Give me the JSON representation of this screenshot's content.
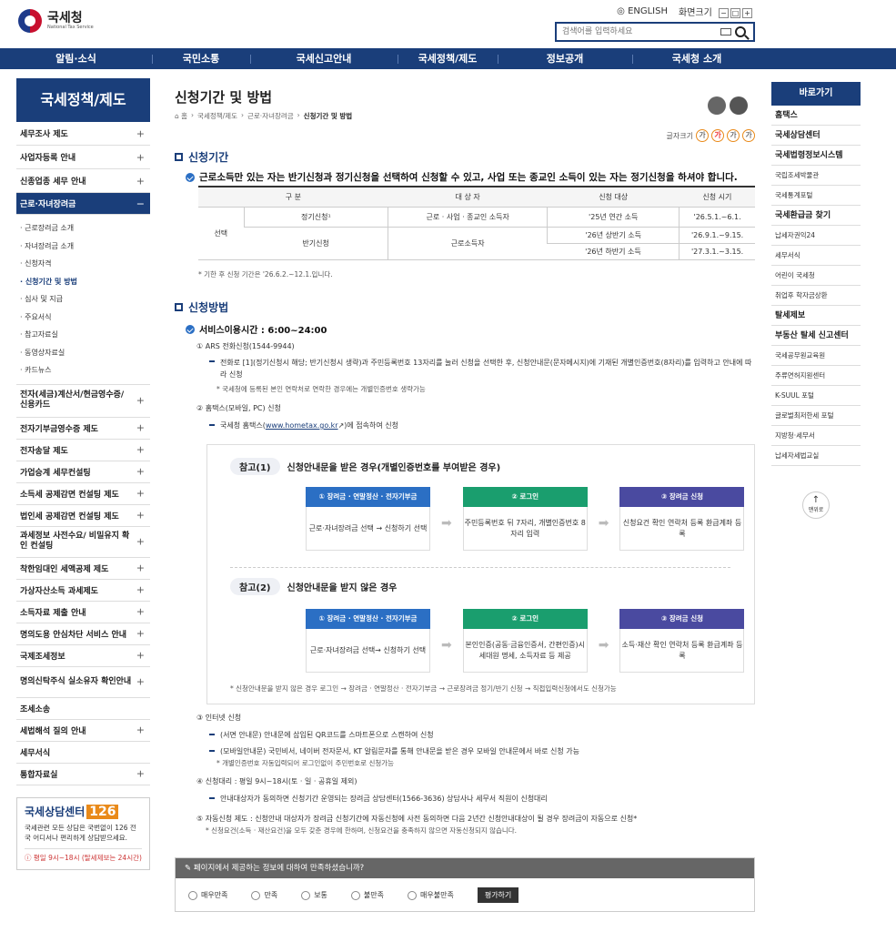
{
  "header": {
    "org_name": "국세청",
    "org_sub": "National Tax Service",
    "english": "ENGLISH",
    "zoom_label": "화면크기",
    "zoom_buttons": [
      "−",
      "□",
      "+"
    ],
    "search_placeholder": "검색어를 입력하세요"
  },
  "gnb": [
    "알림·소식",
    "국민소통",
    "국세신고안내",
    "국세정책/제도",
    "정보공개",
    "국세청 소개"
  ],
  "sidebar": {
    "title": "국세정책/제도",
    "items_top": [
      "세무조사 제도",
      "사업자등록 안내",
      "신종업종 세무 안내"
    ],
    "active": "근로·자녀장려금",
    "sub": [
      "· 근로장려금 소개",
      "· 자녀장려금 소개",
      "· 신청자격",
      "· 신청기간 및 방법",
      "· 심사 및 지급",
      "· 주요서식",
      "· 참고자료실",
      "· 동영상자료실",
      "· 카드뉴스"
    ],
    "items_bottom": [
      "전자(세금)계산서/현금영수증/ 신용카드",
      "전자기부금영수증 제도",
      "전자송달 제도",
      "가업승계 세무컨설팅",
      "소득세 공제감면 컨설팅 제도",
      "법인세 공제감면 컨설팅 제도",
      "과세정보 사전수요/ 비밀유지 확인 컨설팅",
      "착한임대인 세액공제 제도",
      "가상자산소득 과세제도",
      "소득자료 제출 안내",
      "명의도용 안심차단 서비스 안내",
      "국제조세정보",
      "명의신탁주식 실소유자 확인안내",
      "조세소송",
      "세법해석 질의 안내",
      "세무서식",
      "통합자료실"
    ]
  },
  "callcenter": {
    "title": "국세상담센터",
    "number": "126",
    "desc": "국세관련 모든 상담은 국번없이 126 전국 어디서나 편리하게 상담받으세요.",
    "time": "ⓘ 평일 9시~18시 (탈세제보는 24시간)"
  },
  "main": {
    "title": "신청기간 및 방법",
    "breadcrumb": [
      "⌂ 홈",
      "국세정책/제도",
      "근로·자녀장려금",
      "신청기간 및 방법"
    ],
    "fontsize_label": "글자크기",
    "fontsize_buttons": [
      "가",
      "가",
      "가",
      "가"
    ],
    "sec1_title": "신청기간",
    "sec1_check": "근로소득만 있는 자는 반기신청과 정기신청을 선택하여 신청할 수 있고, 사업 또는 종교인 소득이 있는 자는 정기신청을 하셔야 합니다.",
    "table": {
      "headers": [
        "구 분",
        "대 상 자",
        "신청 대상",
        "신청 시기"
      ],
      "group": "선택",
      "row1": [
        "정기신청¹",
        "근로 · 사업 · 종교인 소득자",
        "'25년 연간 소득",
        "'26.5.1.~6.1."
      ],
      "row2_type": "반기신청",
      "row2_target": "근로소득자",
      "row2a": [
        "'26년 상반기 소득",
        "'26.9.1.~9.15."
      ],
      "row2b": [
        "'26년 하반기 소득",
        "'27.3.1.~3.15."
      ]
    },
    "table_note": "* 기한 후 신청 기간은 '26.6.2.~12.1.입니다.",
    "sec2_title": "신청방법",
    "service_time": "서비스이용시간 : 6:00~24:00",
    "s1": "① ARS 전화신청(1544-9944)",
    "s1_d1": "전화로 [1](정기신청시 해당; 반기신청시 생략)과 주민등록번호 13자리를 눌러 신청을 선택한 후, 신청안내문(문자메시지)에 기재된 개별인증번호(8자리)를 입력하고 안내에 따라 신청",
    "s1_d2": "* 국세청에 등록된 본인 연락처로 연락한 경우에는 개별인증번호 생략가능",
    "s2": "② 홈택스(모바일, PC) 신청",
    "s2_d1a": "국세청 홈택스(",
    "s2_link": "www.hometax.go.kr",
    "s2_d1b": "↗)에 접속하여 신청",
    "ref1_label": "참고(1)",
    "ref1_title": "신청안내문을 받은 경우(개별인증번호를 부여받은 경우)",
    "ref2_label": "참고(2)",
    "ref2_title": "신청안내문을 받지 않은 경우",
    "flow_h": [
      "① 장려금 · 연말정산 · 전자기부금",
      "② 로그인",
      "③ 장려금 신청"
    ],
    "flow_colors": [
      "#2b6fc4",
      "#1a9e6e",
      "#4a4aa0"
    ],
    "flow1": [
      "근로·자녀장려금 선택 → 신청하기 선택",
      "주민등록번호 뒤 7자리, 개별인증번호 8자리 입력",
      "신청요건 확인 연락처 등록 환급계좌 등록"
    ],
    "flow2": [
      "근로·자녀장려금 선택→ 신청하기 선택",
      "본인인증(공동·금융인증서, 간편인증)시 세대원 명세, 소득자료 등 제공",
      "소득·재산 확인 연락처 등록 환급계좌 등록"
    ],
    "ref_note": "* 신청안내문을 받지 않은 경우 로그인 → 장려금 · 연말정산 · 전자기부금 → 근로장려금 정기/반기 신청 → 직접입력신청에서도 신청가능",
    "s3": "③ 인터넷 신청",
    "s3_d1": "(서면 안내문) 안내문에 삽입된 QR코드를 스마트폰으로 스캔하여 신청",
    "s3_d2": "(모바일안내문) 국민비서, 네이버 전자문서, KT 알림문자를 통해 안내문을 받은 경우 모바일 안내문에서 바로 신청 가능",
    "s3_d3": "* 개별인증번호 자동입력되어 로그인없이 주민번호로 신청가능",
    "s4": "④ 신청대리 : 평일 9시~18시(토 · 일 · 공휴일 제외)",
    "s4_d1": "안내대상자가 동의하면 신청기간 운영되는 장려금 상담센터(1566-3636) 상담사나 세무서 직원이 신청대리",
    "s5": "⑤ 자동신청 제도 : 신청안내 대상자가 장려금 신청기간에 자동신청에 사전 동의하면 다음 2년간 신청안내대상이 될 경우 장려금이 자동으로 신청*",
    "s5_d": "* 신청요건(소득 · 재산요건)을 모두 갖춘 경우에 한하며, 신청요건을 충족하지 않으면 자동신청되지 않습니다."
  },
  "survey": {
    "title": "페이지에서 제공하는 정보에 대하여 만족하셨습니까?",
    "options": [
      "매우만족",
      "만족",
      "보통",
      "불만족",
      "매우불만족"
    ],
    "button": "평가하기"
  },
  "quick": {
    "title": "바로가기",
    "items": [
      "홈택스",
      "국세상담센터",
      "국세법령정보시스템",
      "국립조세박물관",
      "국세통계포털",
      "국세환급금 찾기",
      "납세자권익24",
      "세무서식",
      "어린이 국세청",
      "취업후 학자금상환",
      "탈세제보",
      "부동산 탈세 신고센터",
      "국세공무원교육원",
      "주류면허지원센터",
      "K-SUUL 포털",
      "글로벌최저한세 포털",
      "지방청·세무서",
      "납세자세법교실"
    ],
    "bold": [
      true,
      true,
      true,
      false,
      false,
      true,
      false,
      false,
      false,
      false,
      true,
      true,
      false,
      false,
      false,
      false,
      false,
      false
    ],
    "top_label": "맨위로"
  }
}
